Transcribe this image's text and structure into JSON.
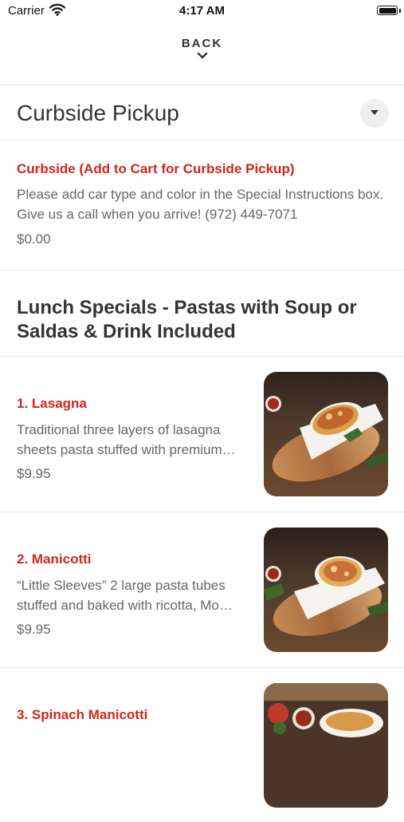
{
  "status_bar": {
    "carrier": "Carrier",
    "time": "4:17 AM"
  },
  "nav": {
    "back_label": "BACK"
  },
  "section": {
    "title": "Curbside Pickup"
  },
  "curbside_item": {
    "name": "Curbside (Add to Cart for Curbside Pickup)",
    "description": "Please add car type and color in the Special Instructions box. Give us a call when you arrive! (972) 449-7071",
    "price": "$0.00"
  },
  "category": {
    "title": "Lunch Specials - Pastas with Soup or Saldas & Drink Included"
  },
  "menu_items": [
    {
      "name": "1. Lasagna",
      "description": "Traditional three layers of lasagna sheets pasta stuffed with premium…",
      "price": "$9.95"
    },
    {
      "name": "2. Manicotti",
      "description": "“Little Sleeves” 2 large pasta tubes stuffed and baked with ricotta, Mo…",
      "price": "$9.95"
    },
    {
      "name": "3. Spinach Manicotti",
      "description": "",
      "price": ""
    }
  ],
  "colors": {
    "accent": "#d0261b",
    "text_primary": "#333333",
    "text_secondary": "#666666",
    "divider": "#e6e6e6"
  },
  "icons": {
    "wifi": "wifi-icon",
    "battery": "battery-icon",
    "back": "chevron-down-icon",
    "dropdown": "caret-down-icon"
  }
}
